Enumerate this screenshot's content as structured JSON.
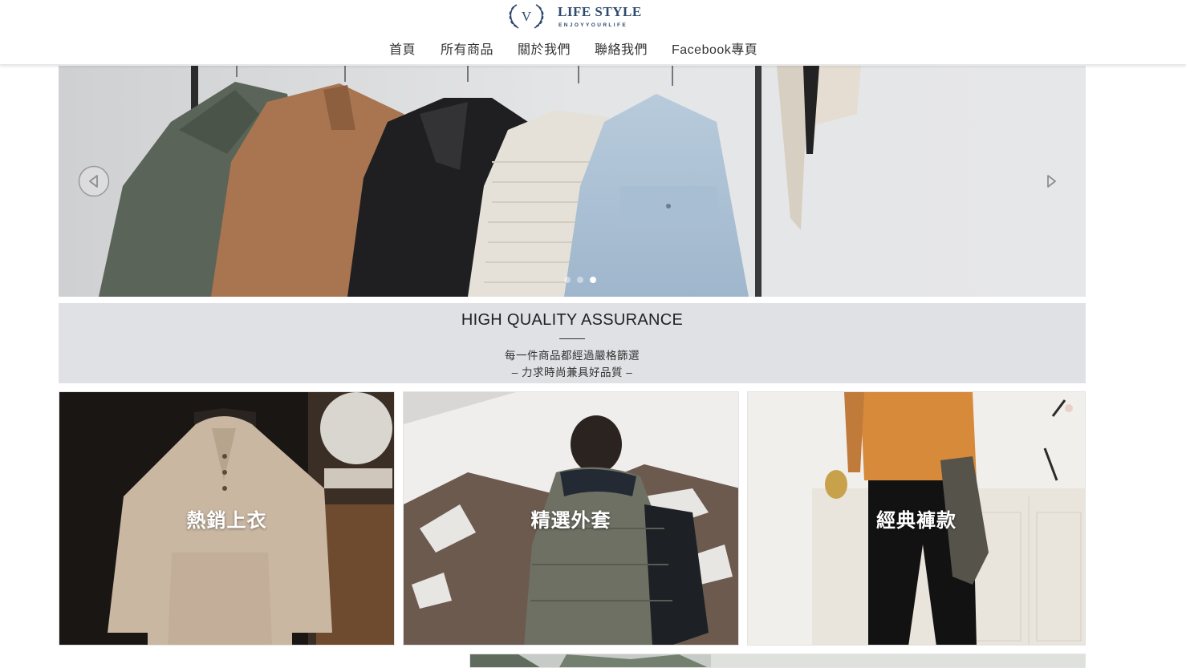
{
  "header": {
    "logo": {
      "mark_letter": "V",
      "name": "LIFE STYLE",
      "tagline": "ENJOYYOURLIFE"
    },
    "nav": [
      {
        "label": "首頁"
      },
      {
        "label": "所有商品"
      },
      {
        "label": "關於我們"
      },
      {
        "label": "聯絡我們"
      },
      {
        "label": "Facebook專頁"
      }
    ]
  },
  "hero": {
    "prev_icon": "caret-left-icon",
    "next_icon": "caret-right-icon",
    "slide_count": 3,
    "active_slide": 2
  },
  "quality": {
    "title": "HIGH QUALITY ASSURANCE",
    "line1": "每一件商品都經過嚴格篩選",
    "line2": "– 力求時尚兼具好品質 –"
  },
  "categories": [
    {
      "label": "熱銷上衣"
    },
    {
      "label": "精選外套"
    },
    {
      "label": "經典褲款"
    }
  ],
  "colors": {
    "brand_navy": "#2f4a6d",
    "banner_gray": "#e0e1e5",
    "nav_text": "#333333"
  }
}
